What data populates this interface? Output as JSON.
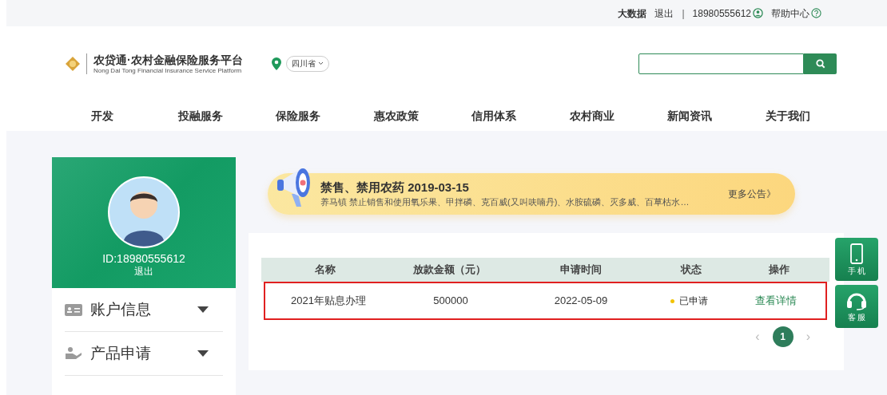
{
  "top_bar": {
    "links": [
      "大数据",
      "退出",
      "18980555612",
      "帮助中心"
    ],
    "separator": "|"
  },
  "header": {
    "logo_title": "农贷通·农村金融保险服务平台",
    "logo_subtitle": "Nong Dai Tong Financial Insurance Service Platform",
    "region": "四川省"
  },
  "nav": [
    {
      "label": "开发"
    },
    {
      "label": "投融服务"
    },
    {
      "label": "保险服务"
    },
    {
      "label": "惠农政策"
    },
    {
      "label": "信用体系"
    },
    {
      "label": "农村商业"
    },
    {
      "label": "新闻资讯"
    },
    {
      "label": "关于我们"
    }
  ],
  "profile": {
    "id": "ID:18980555612",
    "logout": "退出"
  },
  "sidebar": {
    "items": [
      {
        "label": "账户信息",
        "kind": "card",
        "expanded": false
      },
      {
        "label": "产品申请",
        "kind": "hand",
        "expanded": false
      }
    ]
  },
  "notice": {
    "title": "禁售、禁用农药 2019-03-15",
    "text": "养马镇 禁止销售和使用氧乐果、甲拌磷、克百威(又叫呋喃丹)、水胺硫磷、灭多威、百草枯水…",
    "more": "更多公告》"
  },
  "table": {
    "columns": [
      "名称",
      "放款金额（元）",
      "申请时间",
      "状态",
      "操作"
    ],
    "rows": [
      {
        "name": "2021年贴息办理",
        "amount": "500000",
        "date": "2022-05-09",
        "status": "已申请",
        "color": "#f2c200",
        "action": "查看详情",
        "highlighted": true
      }
    ]
  },
  "pagination": {
    "prev": "‹",
    "pages": [
      {
        "label": "1",
        "selected": true
      }
    ],
    "next": "›"
  },
  "float_buttons": [
    {
      "label": "手 机",
      "kind": "phone"
    },
    {
      "label": "客 服",
      "kind": "headset"
    }
  ]
}
